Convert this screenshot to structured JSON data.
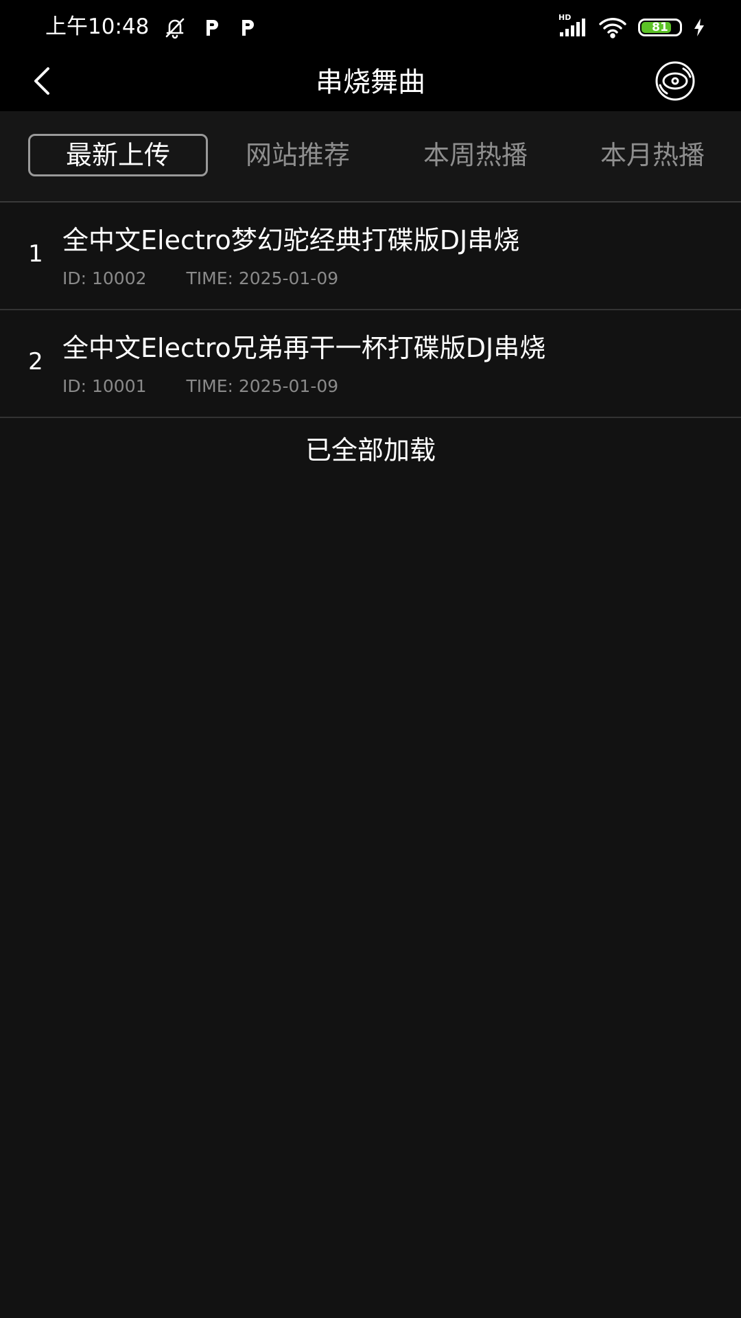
{
  "status_bar": {
    "time": "上午10:48",
    "network_label": "HD",
    "battery_level": 81,
    "battery_text": "81",
    "icons": [
      "bell-off-icon",
      "p-app-icon",
      "p-app-icon",
      "signal-icon",
      "wifi-icon",
      "battery-icon",
      "charging-icon"
    ]
  },
  "nav": {
    "title": "串烧舞曲",
    "back_icon": "chevron-left-icon",
    "disc_icon": "disc-icon"
  },
  "tabs": [
    {
      "label": "最新上传",
      "active": true
    },
    {
      "label": "网站推荐",
      "active": false
    },
    {
      "label": "本周热播",
      "active": false
    },
    {
      "label": "本月热播",
      "active": false
    }
  ],
  "list": {
    "items": [
      {
        "index": "1",
        "title": "全中文Electro梦幻驼经典打碟版DJ串烧",
        "id": "ID: 10002",
        "time": "TIME: 2025-01-09"
      },
      {
        "index": "2",
        "title": "全中文Electro兄弟再干一杯打碟版DJ串烧",
        "id": "ID: 10001",
        "time": "TIME: 2025-01-09"
      }
    ],
    "footer": "已全部加载"
  },
  "colors": {
    "background": "#121212",
    "header": "#000000",
    "battery_fill": "#5cc227",
    "inactive_tab": "#8e8e8e"
  }
}
